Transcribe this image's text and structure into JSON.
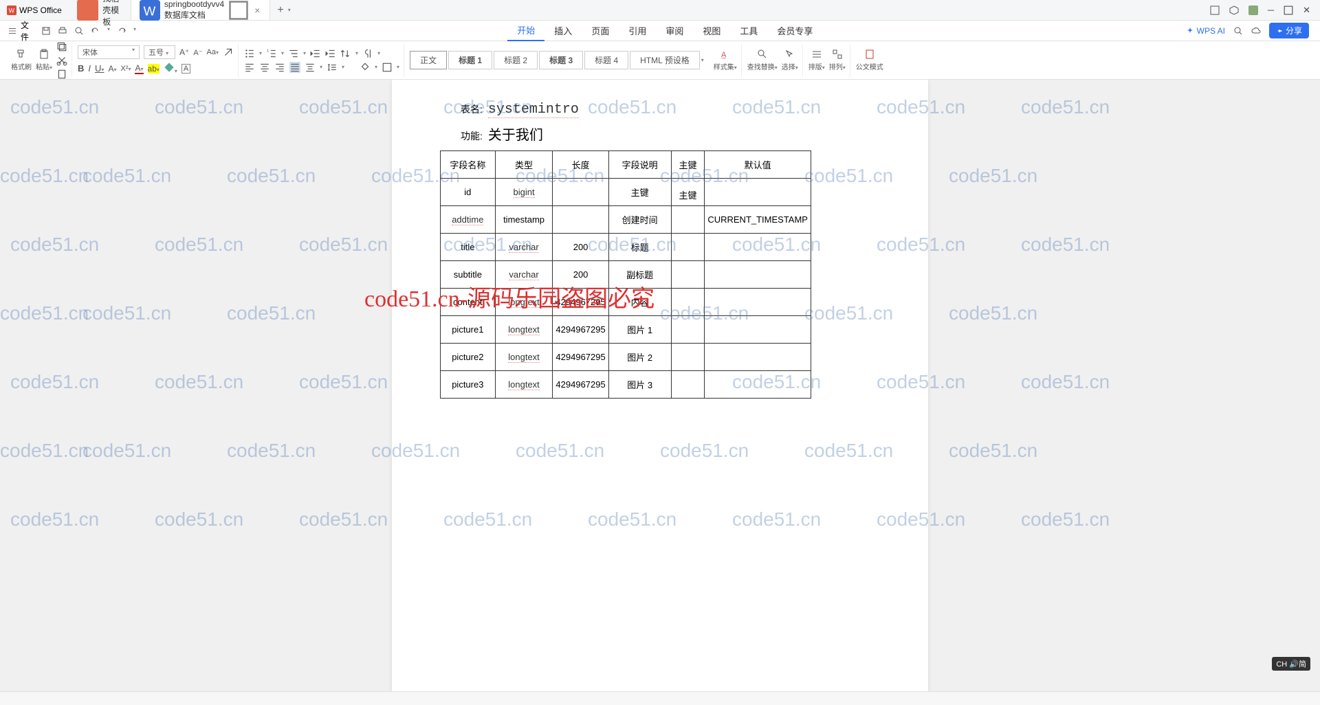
{
  "titlebar": {
    "app_name": "WPS Office",
    "tabs": [
      {
        "icon": "template",
        "label": "找稻壳模板"
      },
      {
        "icon": "doc",
        "label": "springbootdyvv4数据库文档",
        "active": true
      }
    ],
    "add": "+"
  },
  "menubar": {
    "file_label": "文件",
    "menu_tabs": [
      "开始",
      "插入",
      "页面",
      "引用",
      "审阅",
      "视图",
      "工具",
      "会员专享"
    ],
    "active_tab": "开始",
    "wps_ai": "WPS AI",
    "share": "分享"
  },
  "ribbon": {
    "format_painter": "格式刷",
    "paste": "粘贴",
    "font_name": "宋体",
    "font_size": "五号",
    "styles": {
      "normal": "正文",
      "h1": "标题 1",
      "h2": "标题 2",
      "h3": "标题 3",
      "h4": "标题 4",
      "html": "HTML 预设格"
    },
    "style_set": "样式集",
    "find_replace": "查找替换",
    "select": "选择",
    "sort": "排版",
    "arrange": "排列",
    "official": "公文模式"
  },
  "document": {
    "table_name_label": "表名:",
    "table_name": "systemintro",
    "function_label": "功能:",
    "function_value": "关于我们",
    "headers": [
      "字段名称",
      "类型",
      "长度",
      "字段说明",
      "主键",
      "默认值"
    ],
    "rows": [
      {
        "name": "id",
        "type": "bigint",
        "len": "",
        "desc": "主键",
        "pk": "主键",
        "def": ""
      },
      {
        "name": "addtime",
        "type": "timestamp",
        "len": "",
        "desc": "创建时间",
        "pk": "",
        "def": "CURRENT_TIMESTAMP"
      },
      {
        "name": "title",
        "type": "varchar",
        "len": "200",
        "desc": "标题",
        "pk": "",
        "def": ""
      },
      {
        "name": "subtitle",
        "type": "varchar",
        "len": "200",
        "desc": "副标题",
        "pk": "",
        "def": ""
      },
      {
        "name": "content",
        "type": "longtext",
        "len": "4294967295",
        "desc": "内容",
        "pk": "",
        "def": ""
      },
      {
        "name": "picture1",
        "type": "longtext",
        "len": "4294967295",
        "desc": "图片 1",
        "pk": "",
        "def": ""
      },
      {
        "name": "picture2",
        "type": "longtext",
        "len": "4294967295",
        "desc": "图片 2",
        "pk": "",
        "def": ""
      },
      {
        "name": "picture3",
        "type": "longtext",
        "len": "4294967295",
        "desc": "图片 3",
        "pk": "",
        "def": ""
      }
    ]
  },
  "watermark": {
    "text": "code51.cn",
    "red": "code51.cn-源码乐园盗图必究"
  },
  "ime": "CH 🔊简"
}
